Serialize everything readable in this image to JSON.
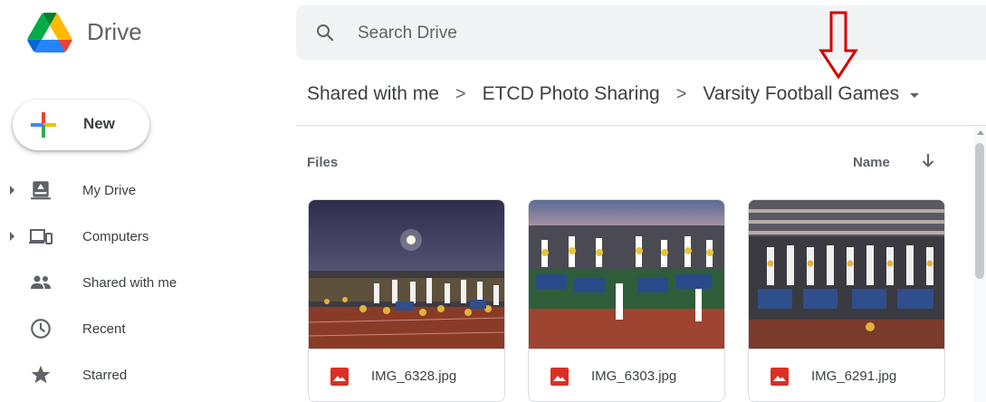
{
  "app": {
    "name": "Drive"
  },
  "search": {
    "placeholder": "Search Drive"
  },
  "breadcrumb": {
    "items": [
      "Shared with me",
      "ETCD Photo Sharing",
      "Varsity Football Games"
    ],
    "separator": ">"
  },
  "new_button": {
    "label": "New"
  },
  "sidebar": {
    "items": [
      {
        "label": "My Drive",
        "icon": "my-drive-icon"
      },
      {
        "label": "Computers",
        "icon": "computers-icon"
      },
      {
        "label": "Shared with me",
        "icon": "shared-with-me-icon"
      },
      {
        "label": "Recent",
        "icon": "recent-clock-icon"
      },
      {
        "label": "Starred",
        "icon": "star-icon"
      }
    ]
  },
  "files": {
    "section_label": "Files",
    "sort_label": "Name",
    "sort_direction": "descending",
    "items": [
      {
        "name": "IMG_6328.jpg",
        "type": "image"
      },
      {
        "name": "IMG_6303.jpg",
        "type": "image"
      },
      {
        "name": "IMG_6291.jpg",
        "type": "image"
      }
    ]
  },
  "colors": {
    "accent_red": "#d93025",
    "annotation_red": "#d40000",
    "text_primary": "#3c4043",
    "text_secondary": "#5f6368",
    "search_bg": "#f1f3f4",
    "divider": "#dadce0"
  }
}
